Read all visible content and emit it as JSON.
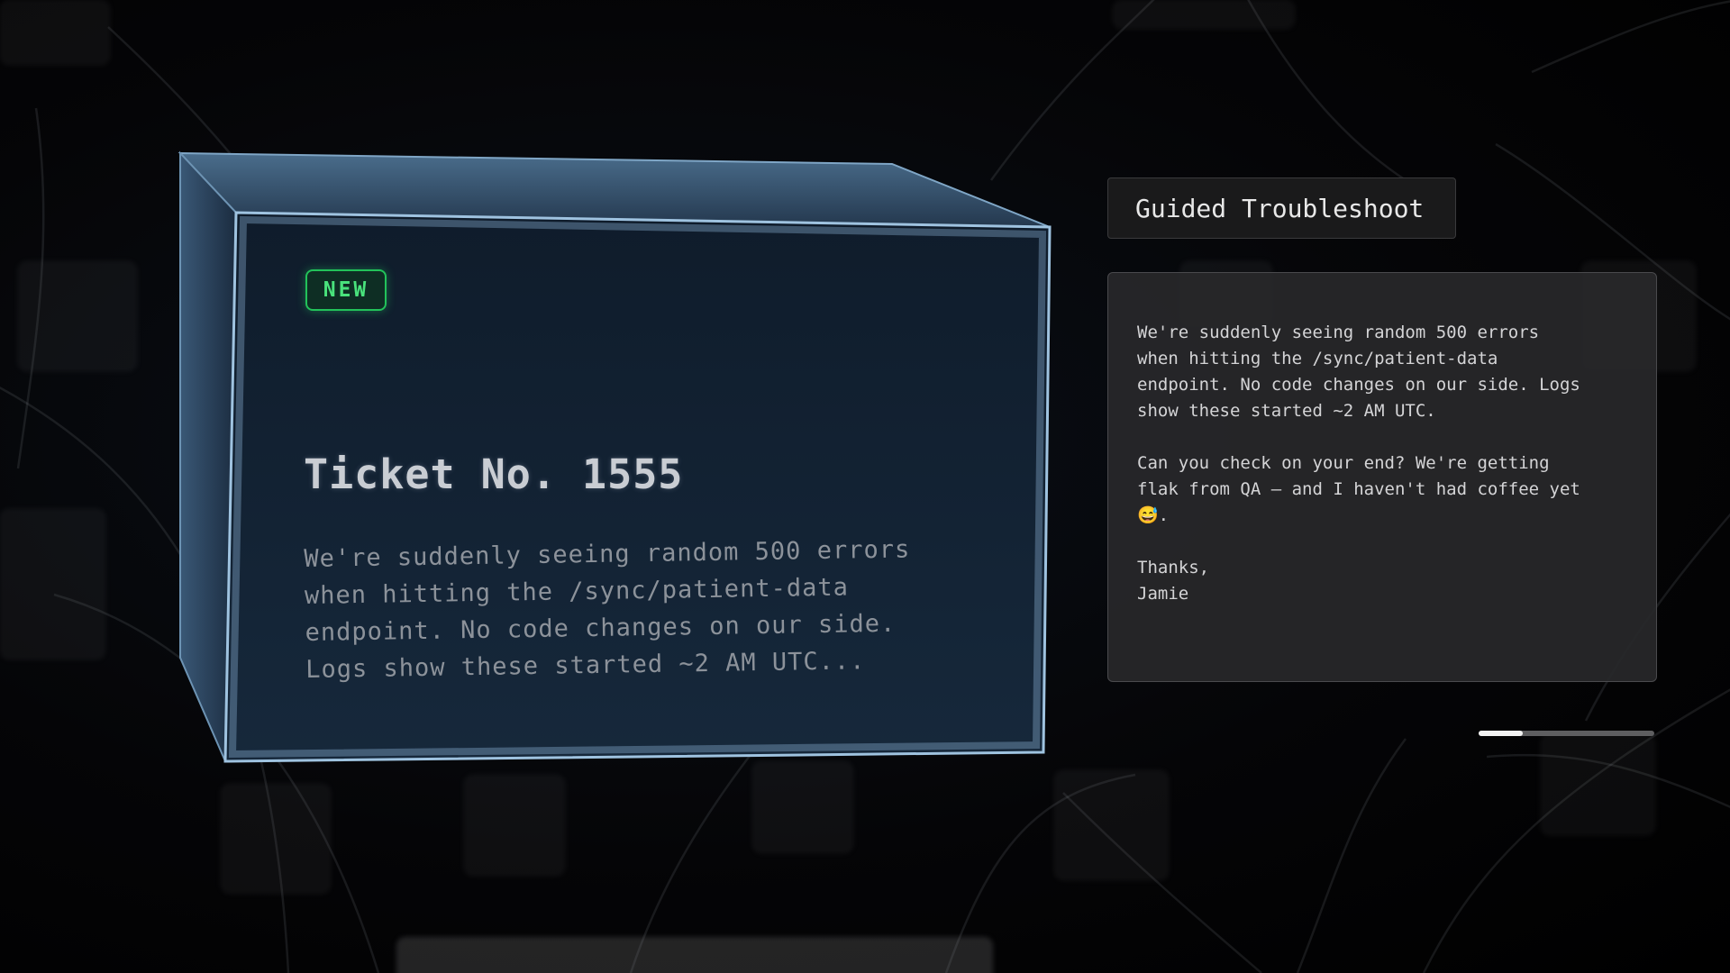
{
  "ticket": {
    "status": "NEW",
    "title": "Ticket No. 1555",
    "preview_lines": [
      "We're suddenly seeing random 500 errors",
      "when hitting the /sync/patient-data",
      "endpoint. No code changes on our side.",
      "Logs show these started ~2 AM UTC..."
    ],
    "badge_color": "#22c25a"
  },
  "panel": {
    "title": "Guided Troubleshoot",
    "message": {
      "paragraph1_lines": [
        "We're suddenly seeing random 500 errors",
        "when hitting the /sync/patient-data",
        "endpoint. No code changes on our side. Logs",
        "show these started ~2 AM UTC."
      ],
      "paragraph2_lines": [
        "Can you check on your end? We're getting",
        "flak from QA — and I haven't had coffee yet",
        "😅."
      ],
      "signoff": "Thanks,",
      "name": "Jamie"
    }
  },
  "progress": {
    "value": 0.25
  }
}
